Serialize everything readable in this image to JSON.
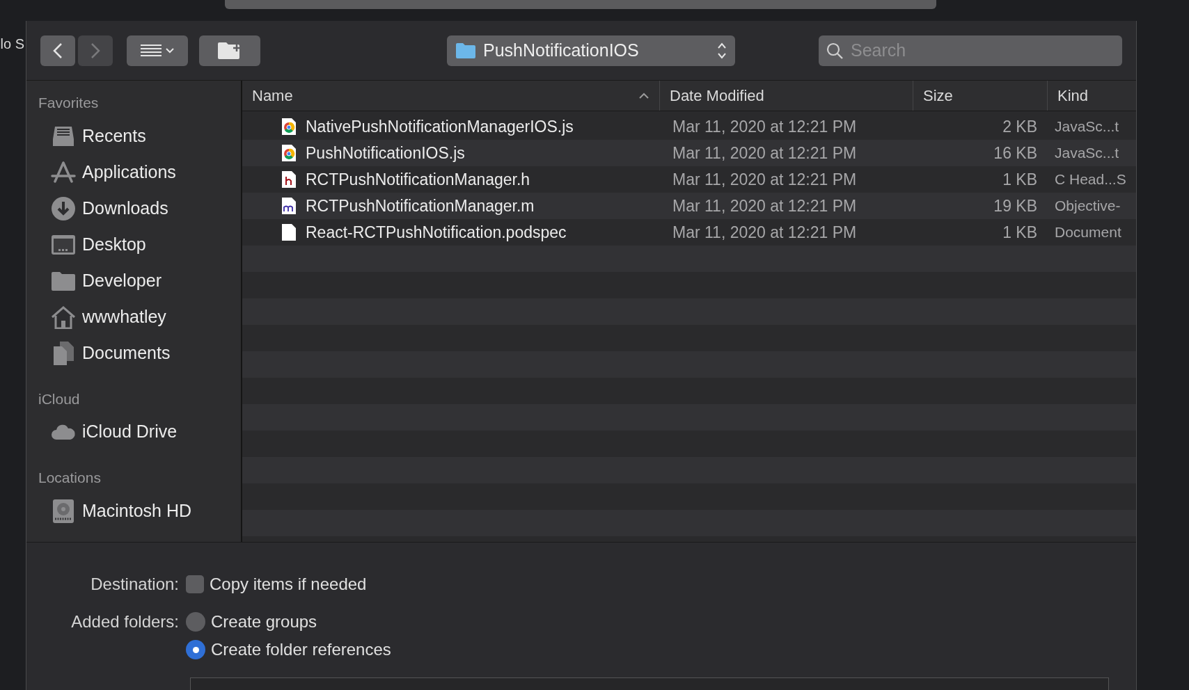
{
  "background_window": {
    "text": "lo S"
  },
  "toolbar": {
    "path_popup": "PushNotificationIOS",
    "search": {
      "placeholder": "Search"
    }
  },
  "sidebar": {
    "sections": [
      {
        "title": "Favorites",
        "items": [
          {
            "label": "Recents",
            "kind": "recents"
          },
          {
            "label": "Applications",
            "kind": "applications"
          },
          {
            "label": "Downloads",
            "kind": "downloads"
          },
          {
            "label": "Desktop",
            "kind": "desktop"
          },
          {
            "label": "Developer",
            "kind": "folder"
          },
          {
            "label": "wwwhatley",
            "kind": "home"
          },
          {
            "label": "Documents",
            "kind": "documents"
          }
        ]
      },
      {
        "title": "iCloud",
        "items": [
          {
            "label": "iCloud Drive",
            "kind": "cloud"
          }
        ]
      },
      {
        "title": "Locations",
        "items": [
          {
            "label": "Macintosh HD",
            "kind": "disk"
          }
        ]
      }
    ]
  },
  "table": {
    "columns": [
      {
        "label": "Name",
        "sorted": true
      },
      {
        "label": "Date Modified",
        "sorted": false
      },
      {
        "label": "Size",
        "sorted": false
      },
      {
        "label": "Kind",
        "sorted": false
      }
    ],
    "rows": [
      {
        "kind": "js",
        "name": "NativePushNotificationManagerIOS.js",
        "date": "Mar 11, 2020 at 12:21 PM",
        "size": "2 KB",
        "file_kind": "JavaSc...t"
      },
      {
        "kind": "js",
        "name": "PushNotificationIOS.js",
        "date": "Mar 11, 2020 at 12:21 PM",
        "size": "16 KB",
        "file_kind": "JavaSc...t"
      },
      {
        "kind": "h",
        "name": "RCTPushNotificationManager.h",
        "date": "Mar 11, 2020 at 12:21 PM",
        "size": "1 KB",
        "file_kind": "C Head...S"
      },
      {
        "kind": "m",
        "name": "RCTPushNotificationManager.m",
        "date": "Mar 11, 2020 at 12:21 PM",
        "size": "19 KB",
        "file_kind": "Objective-"
      },
      {
        "kind": "doc",
        "name": "React-RCTPushNotification.podspec",
        "date": "Mar 11, 2020 at 12:21 PM",
        "size": "1 KB",
        "file_kind": "Document"
      }
    ]
  },
  "options": {
    "destination": {
      "label": "Destination:",
      "checkbox": {
        "label": "Copy items if needed",
        "checked": false
      }
    },
    "added_folders": {
      "label": "Added folders:",
      "radios": [
        {
          "label": "Create groups",
          "selected": false
        },
        {
          "label": "Create folder references",
          "selected": true
        }
      ]
    }
  }
}
